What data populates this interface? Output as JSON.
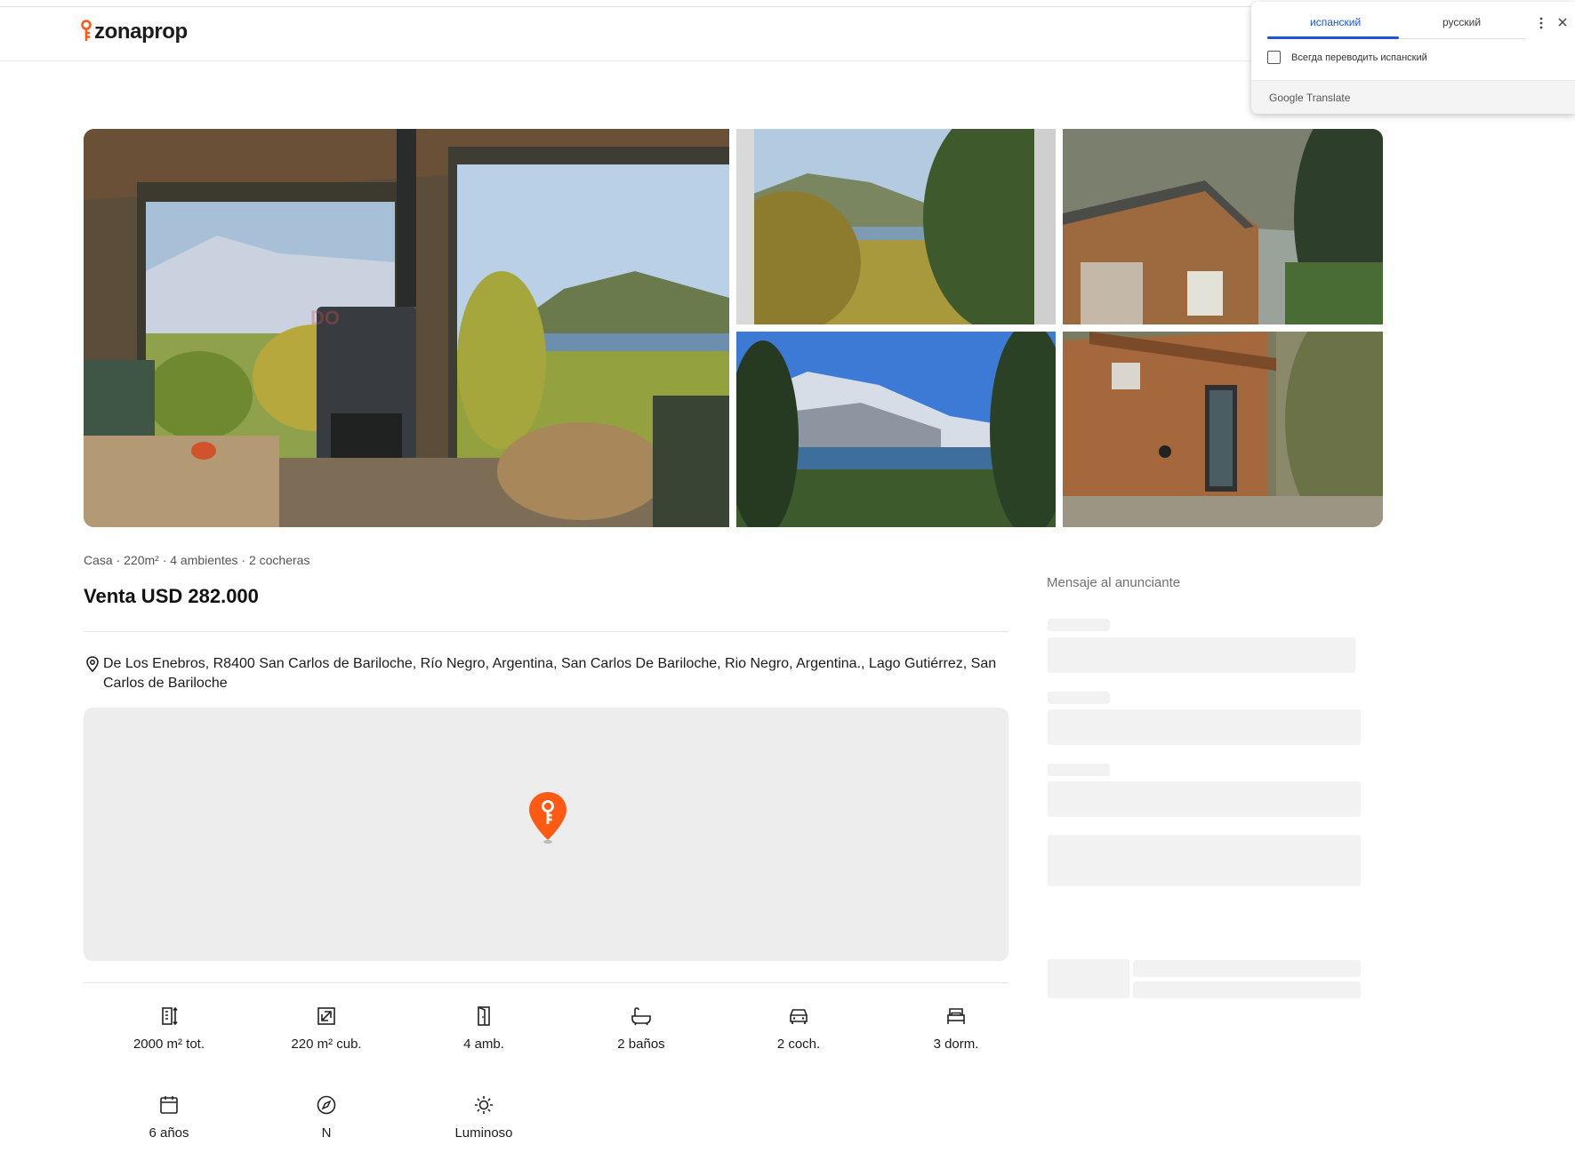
{
  "header": {
    "logo_text": "zonaprop",
    "brand_color": "#ff5a14"
  },
  "gallery": {
    "watermark": "Dolores Ojeda",
    "photos": [
      {
        "name": "living-room-stove-lake-view"
      },
      {
        "name": "forest-lake-mountain-view"
      },
      {
        "name": "wooden-house-roof"
      },
      {
        "name": "snowy-mountain-lake-view"
      },
      {
        "name": "wooden-house-side"
      }
    ]
  },
  "listing": {
    "summary": "Casa · 220m² · 4 ambientes · 2 cocheras",
    "price": "Venta USD 282.000",
    "address": "De Los Enebros, R8400 San Carlos de Bariloche, Río Negro, Argentina, San Carlos De Bariloche, Rio Negro, Argentina., Lago Gutiérrez, San Carlos de Bariloche",
    "features": [
      {
        "icon": "total-area-icon",
        "label": "2000 m² tot."
      },
      {
        "icon": "covered-area-icon",
        "label": "220 m² cub."
      },
      {
        "icon": "rooms-door-icon",
        "label": "4 amb."
      },
      {
        "icon": "bathtub-icon",
        "label": "2 baños"
      },
      {
        "icon": "car-icon",
        "label": "2 coch."
      },
      {
        "icon": "bed-icon",
        "label": "3 dorm."
      },
      {
        "icon": "calendar-icon",
        "label": "6 años"
      },
      {
        "icon": "compass-icon",
        "label": "N"
      },
      {
        "icon": "sun-icon",
        "label": "Luminoso"
      }
    ]
  },
  "contact": {
    "title": "Mensaje al anunciante"
  },
  "translate_popup": {
    "tab_source": "испанский",
    "tab_target": "русский",
    "always_translate_label": "Всегда переводить испанский",
    "always_translate_checked": false,
    "brand_google": "Google",
    "brand_translate": "Translate",
    "accent_color": "#1a56d6"
  }
}
